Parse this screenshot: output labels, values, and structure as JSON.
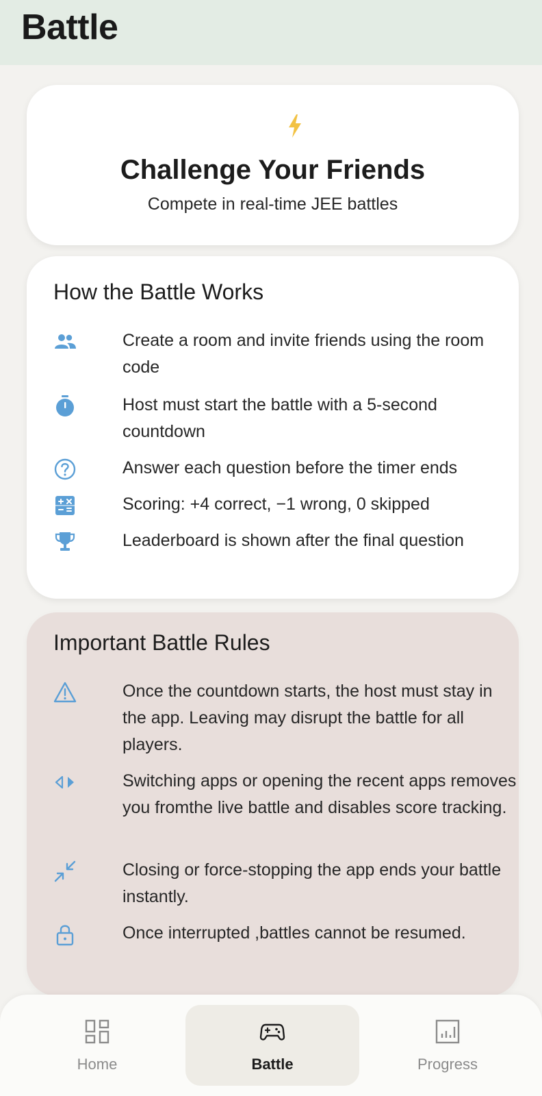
{
  "app_bar": {
    "title": "Battle"
  },
  "hero": {
    "icon": "lightning-bolt-icon",
    "title": "Challenge Your Friends",
    "subtitle": "Compete in real-time JEE battles"
  },
  "how_it_works": {
    "title": "How the Battle Works",
    "items": [
      {
        "icon": "people-icon",
        "text": "Create a room and invite friends using the room code"
      },
      {
        "icon": "stopwatch-icon",
        "text": "Host must start the battle with a 5-second countdown"
      },
      {
        "icon": "question-circle-icon",
        "text": "Answer each question before the timer ends"
      },
      {
        "icon": "calculator-icon",
        "text": "Scoring: +4 correct, −1 wrong, 0 skipped"
      },
      {
        "icon": "trophy-icon",
        "text": "Leaderboard is shown after the final question"
      }
    ]
  },
  "rules": {
    "title": "Important Battle Rules",
    "items": [
      {
        "icon": "warning-icon",
        "text": "Once the countdown starts, the host must stay in the app. Leaving may disrupt the battle for all players."
      },
      {
        "icon": "switch-arrows-icon",
        "text": "Switching apps or opening the recent apps removes you fromthe live battle and disables score tracking."
      },
      {
        "icon": "close-fullscreen-icon",
        "text": "Closing or force-stopping the app ends your battle instantly."
      },
      {
        "icon": "lock-icon",
        "text": "Once interrupted ,battles cannot be resumed."
      }
    ]
  },
  "bottom_nav": {
    "items": [
      {
        "label": "Home",
        "icon": "dashboard-icon",
        "active": false
      },
      {
        "label": "Battle",
        "icon": "gamepad-icon",
        "active": true
      },
      {
        "label": "Progress",
        "icon": "chart-icon",
        "active": false
      }
    ]
  },
  "colors": {
    "accent": "#5b9fd6",
    "bolt": "#f2c244",
    "app_bar": "#e3ece4",
    "rules_bg": "#e8dedb"
  }
}
